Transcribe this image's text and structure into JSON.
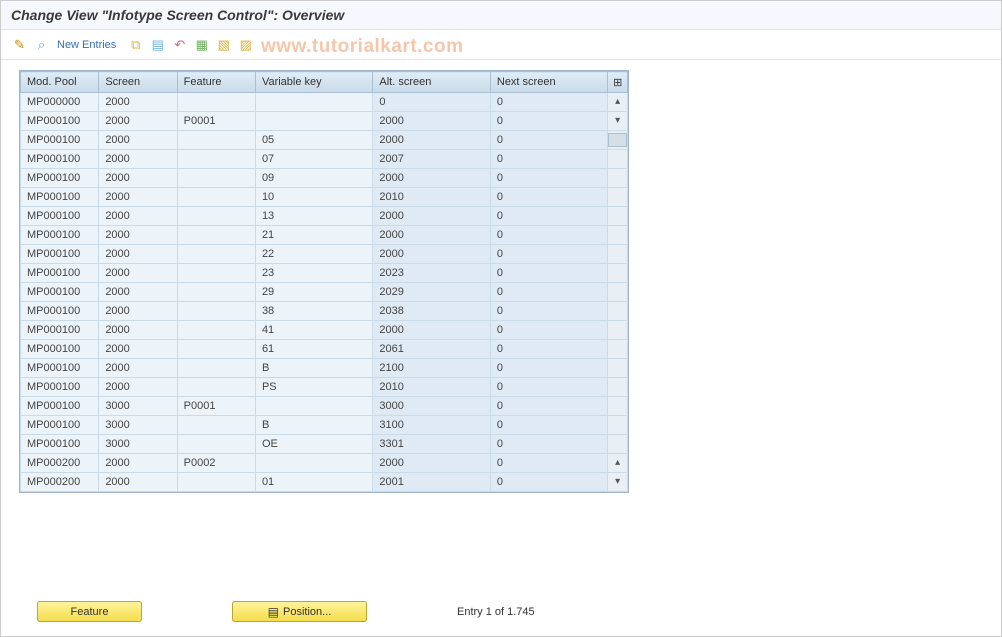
{
  "title": "Change View \"Infotype Screen Control\": Overview",
  "watermark": "www.tutorialkart.com",
  "toolbar": {
    "new_entries": "New Entries"
  },
  "table": {
    "headers": {
      "modpool": "Mod. Pool",
      "screen": "Screen",
      "feature": "Feature",
      "varkey": "Variable key",
      "altscreen": "Alt. screen",
      "nextscreen": "Next screen"
    },
    "rows": [
      {
        "modpool": "MP000000",
        "screen": "2000",
        "feature": "",
        "varkey": "",
        "altscreen": "0",
        "nextscreen": "0"
      },
      {
        "modpool": "MP000100",
        "screen": "2000",
        "feature": "P0001",
        "varkey": "",
        "altscreen": "2000",
        "nextscreen": "0"
      },
      {
        "modpool": "MP000100",
        "screen": "2000",
        "feature": "",
        "varkey": "05",
        "altscreen": "2000",
        "nextscreen": "0"
      },
      {
        "modpool": "MP000100",
        "screen": "2000",
        "feature": "",
        "varkey": "07",
        "altscreen": "2007",
        "nextscreen": "0"
      },
      {
        "modpool": "MP000100",
        "screen": "2000",
        "feature": "",
        "varkey": "09",
        "altscreen": "2000",
        "nextscreen": "0"
      },
      {
        "modpool": "MP000100",
        "screen": "2000",
        "feature": "",
        "varkey": "10",
        "altscreen": "2010",
        "nextscreen": "0"
      },
      {
        "modpool": "MP000100",
        "screen": "2000",
        "feature": "",
        "varkey": "13",
        "altscreen": "2000",
        "nextscreen": "0"
      },
      {
        "modpool": "MP000100",
        "screen": "2000",
        "feature": "",
        "varkey": "21",
        "altscreen": "2000",
        "nextscreen": "0"
      },
      {
        "modpool": "MP000100",
        "screen": "2000",
        "feature": "",
        "varkey": "22",
        "altscreen": "2000",
        "nextscreen": "0"
      },
      {
        "modpool": "MP000100",
        "screen": "2000",
        "feature": "",
        "varkey": "23",
        "altscreen": "2023",
        "nextscreen": "0"
      },
      {
        "modpool": "MP000100",
        "screen": "2000",
        "feature": "",
        "varkey": "29",
        "altscreen": "2029",
        "nextscreen": "0"
      },
      {
        "modpool": "MP000100",
        "screen": "2000",
        "feature": "",
        "varkey": "38",
        "altscreen": "2038",
        "nextscreen": "0"
      },
      {
        "modpool": "MP000100",
        "screen": "2000",
        "feature": "",
        "varkey": "41",
        "altscreen": "2000",
        "nextscreen": "0"
      },
      {
        "modpool": "MP000100",
        "screen": "2000",
        "feature": "",
        "varkey": "61",
        "altscreen": "2061",
        "nextscreen": "0"
      },
      {
        "modpool": "MP000100",
        "screen": "2000",
        "feature": "",
        "varkey": "B",
        "altscreen": "2100",
        "nextscreen": "0"
      },
      {
        "modpool": "MP000100",
        "screen": "2000",
        "feature": "",
        "varkey": "PS",
        "altscreen": "2010",
        "nextscreen": "0"
      },
      {
        "modpool": "MP000100",
        "screen": "3000",
        "feature": "P0001",
        "varkey": "",
        "altscreen": "3000",
        "nextscreen": "0"
      },
      {
        "modpool": "MP000100",
        "screen": "3000",
        "feature": "",
        "varkey": "B",
        "altscreen": "3100",
        "nextscreen": "0"
      },
      {
        "modpool": "MP000100",
        "screen": "3000",
        "feature": "",
        "varkey": "OE",
        "altscreen": "3301",
        "nextscreen": "0"
      },
      {
        "modpool": "MP000200",
        "screen": "2000",
        "feature": "P0002",
        "varkey": "",
        "altscreen": "2000",
        "nextscreen": "0"
      },
      {
        "modpool": "MP000200",
        "screen": "2000",
        "feature": "",
        "varkey": "01",
        "altscreen": "2001",
        "nextscreen": "0"
      }
    ]
  },
  "footer": {
    "feature_btn": "Feature",
    "position_btn": "Position...",
    "entry_text": "Entry 1 of 1.745"
  }
}
